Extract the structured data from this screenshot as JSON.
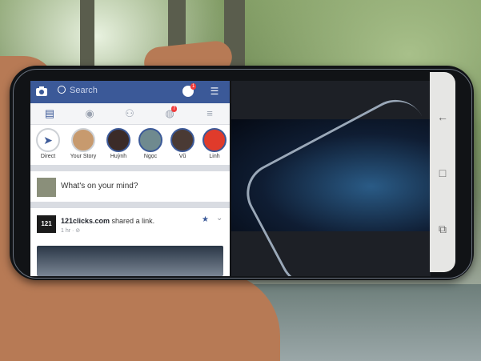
{
  "facebook": {
    "search_placeholder": "Search",
    "messenger_badge": "1",
    "notification_badge": "7",
    "stories": [
      {
        "label": "Direct",
        "color": "#ffffff"
      },
      {
        "label": "Your Story",
        "color": "#c79a6e"
      },
      {
        "label": "Huỳnh",
        "color": "#3b2b28"
      },
      {
        "label": "Ngọc",
        "color": "#6f8a8f"
      },
      {
        "label": "Vũ",
        "color": "#4a3a34"
      },
      {
        "label": "Linh",
        "color": "#e03b2b"
      }
    ],
    "composer_prompt": "What's on your mind?",
    "post": {
      "logo_text": "121",
      "author": "121clicks.com",
      "action": " shared a link.",
      "time": "1 hr · ⊘"
    }
  },
  "colors": {
    "facebook_blue": "#3b5998",
    "badge_red": "#f03c3c"
  }
}
